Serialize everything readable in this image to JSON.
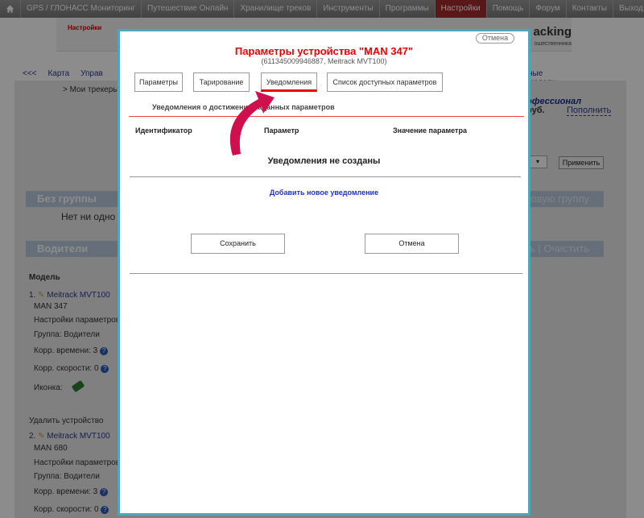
{
  "nav": {
    "items": [
      "GPS / ГЛОНАСС Мониторинг",
      "Путешествие Онлайн",
      "Хранилище треков",
      "Инструменты",
      "Программы",
      "Настройки",
      "Помощь",
      "Форум",
      "Контакты",
      "Выход"
    ],
    "active_index": 5
  },
  "background": {
    "settings_link": "Настройки",
    "brand": "acking",
    "brand_sub": "ошественника",
    "crumb_back": "<<<",
    "crumb_map": "Карта",
    "crumb_manage": "Управ",
    "crumb_models": "ные модели",
    "trackers": "> Мои трекеры",
    "pro_text": "офессионал",
    "rub_text": "руб.",
    "fill_link": "Пополнить",
    "apply_button": "Применить",
    "no_group_title": "Без группы",
    "new_group_link": "новую группу",
    "no_group_empty": "Нет ни одно",
    "drivers_title": "Водители",
    "drivers_actions": "ть | Очистить",
    "list": {
      "header": "Модель",
      "device1": {
        "num": "1.",
        "model": "Meitrack MVT100",
        "name": "MAN 347",
        "params": "Настройки параметров",
        "group": "Группа: Водители",
        "time_corr": "Корр. времени: 3",
        "speed_corr": "Корр. скорости: 0",
        "icon_label": "Иконка:"
      },
      "delete_link": "Удалить устройство",
      "device2": {
        "num": "2.",
        "model": "Meitrack MVT100",
        "name": "MAN 680",
        "params": "Настройки параметров",
        "group": "Группа: Водители",
        "time_corr": "Корр. времени: 3",
        "speed_corr": "Корр. скорости: 0"
      }
    }
  },
  "modal": {
    "close_label": "Отмена",
    "title": "Параметры устройства \"MAN 347\"",
    "subtitle": "(611345009946887, Meitrack MVT100)",
    "tabs": [
      "Параметры",
      "Тарирование",
      "Уведомления",
      "Список доступных параметров"
    ],
    "active_tab": 2,
    "section_label": "Уведомления о достижении заданных параметров",
    "columns": [
      "Идентификатор",
      "Параметр",
      "Значение параметра"
    ],
    "empty_message": "Уведомления не созданы",
    "add_link": "Добавить новое уведомление",
    "save_button": "Сохранить",
    "cancel_button": "Отмена"
  },
  "colors": {
    "accent": "#e00000",
    "modal_border": "#4fa6b8",
    "link": "#2233cc",
    "arrow": "#d0104c"
  },
  "icons": {
    "home": "home-icon",
    "help": "help-icon",
    "edit": "pencil-icon",
    "device": "device-icon",
    "pointer": "curved-arrow-icon"
  }
}
